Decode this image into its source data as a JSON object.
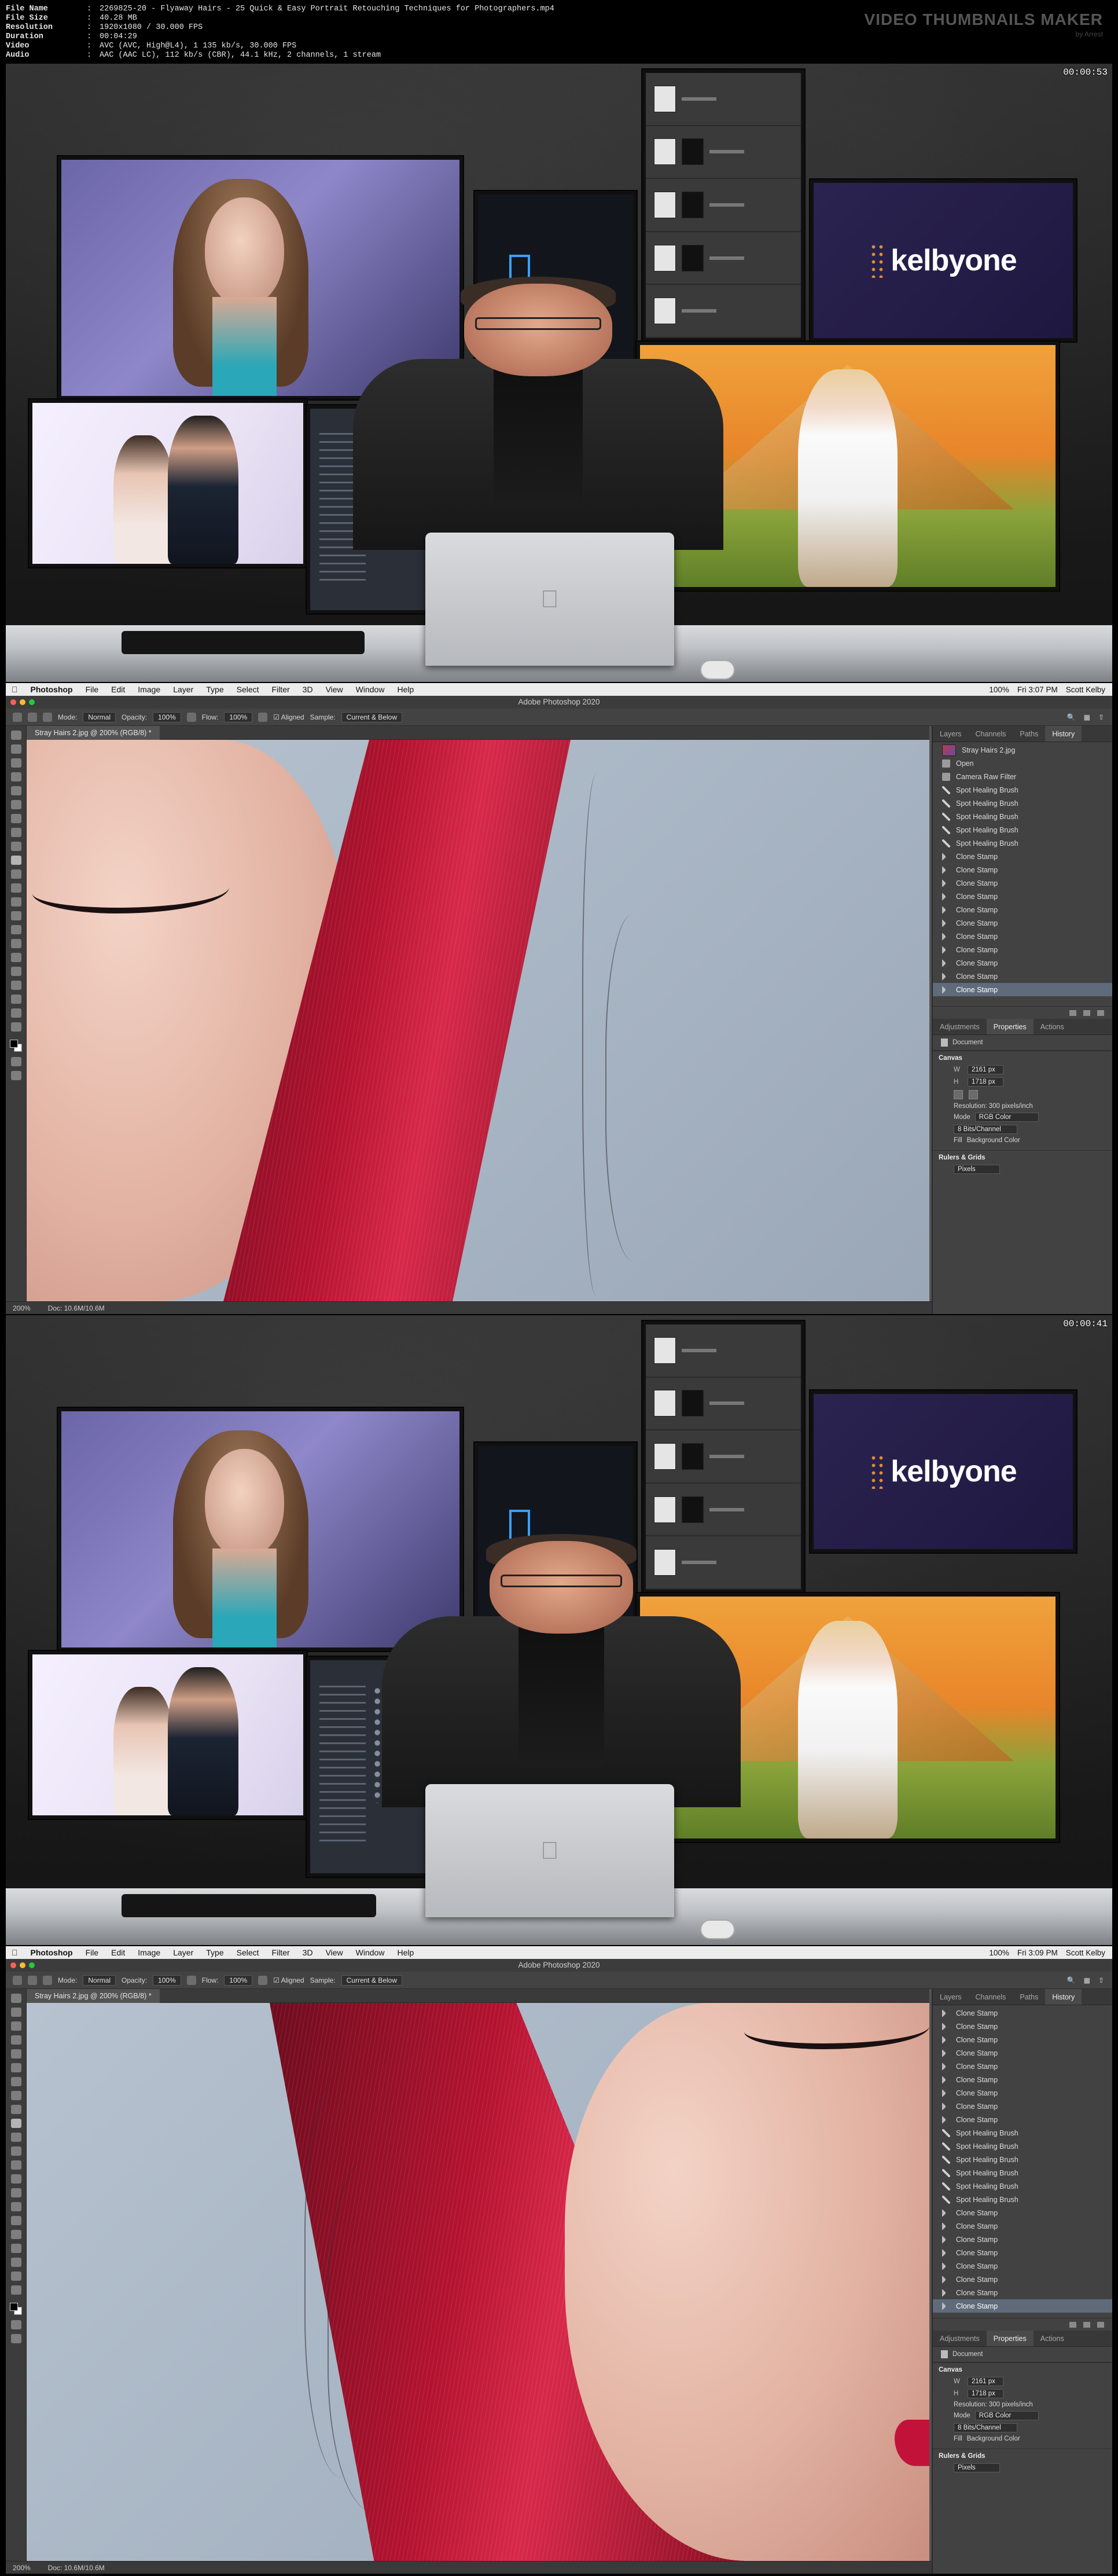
{
  "header": {
    "lines": [
      {
        "key": "File Name",
        "value": "2269825-20 - Flyaway Hairs - 25 Quick & Easy Portrait Retouching Techniques for Photographers.mp4"
      },
      {
        "key": "File Size",
        "value": "40.28 MB"
      },
      {
        "key": "Resolution",
        "value": "1920x1080 / 30.000 FPS"
      },
      {
        "key": "Duration",
        "value": "00:04:29"
      },
      {
        "key": "Video",
        "value": "AVC (AVC, High@L4), 1 135 kb/s, 30.000 FPS"
      },
      {
        "key": "Audio",
        "value": "AAC (AAC LC), 112 kb/s (CBR), 44.1 kHz, 2 channels, 1 stream"
      }
    ],
    "brand_title": "VIDEO THUMBNAILS MAKER",
    "brand_sub": "by Arrest"
  },
  "frames": [
    {
      "timestamp": "00:00:53",
      "kelby_logo": "kelbyone"
    },
    {
      "menubar": {
        "app": "Photoshop",
        "menus": [
          "File",
          "Edit",
          "Image",
          "Layer",
          "Type",
          "Select",
          "Filter",
          "3D",
          "View",
          "Window",
          "Help"
        ],
        "status": [
          "100%",
          "Fri 3:07 PM",
          "Scott Kelby"
        ]
      },
      "title": "Adobe Photoshop 2020",
      "options": {
        "mode_label": "Mode:",
        "mode": "Normal",
        "opacity_label": "Opacity:",
        "opacity": "100%",
        "flow_label": "Flow:",
        "flow": "100%",
        "aligned": "Aligned",
        "sample_label": "Sample:",
        "sample": "Current & Below"
      },
      "doc_tab": "Stray Hairs 2.jpg @ 200% (RGB/8) *",
      "panel_tabs": [
        "Layers",
        "Channels",
        "Paths",
        "History"
      ],
      "history": [
        "Stray Hairs 2.jpg",
        "Open",
        "Camera Raw Filter",
        "Spot Healing Brush",
        "Spot Healing Brush",
        "Spot Healing Brush",
        "Spot Healing Brush",
        "Spot Healing Brush",
        "Clone Stamp",
        "Clone Stamp",
        "Clone Stamp",
        "Clone Stamp",
        "Clone Stamp",
        "Clone Stamp",
        "Clone Stamp",
        "Clone Stamp",
        "Clone Stamp",
        "Clone Stamp",
        "Clone Stamp"
      ],
      "props_tabs": [
        "Adjustments",
        "Properties",
        "Actions"
      ],
      "props": {
        "document": "Document",
        "canvas": "Canvas",
        "w_label": "W",
        "w": "2161 px",
        "h_label": "H",
        "h": "1718 px",
        "resolution": "Resolution: 300 pixels/inch",
        "mode_label": "Mode",
        "mode": "RGB Color",
        "depth": "8 Bits/Channel",
        "fill_label": "Fill",
        "fill": "Background Color",
        "rulers": "Rulers & Grids",
        "units": "Pixels"
      },
      "status": {
        "zoom": "200%",
        "doc_size": "Doc: 10.6M/10.6M"
      }
    },
    {
      "timestamp": "00:00:41",
      "kelby_logo": "kelbyone"
    },
    {
      "menubar": {
        "app": "Photoshop",
        "menus": [
          "File",
          "Edit",
          "Image",
          "Layer",
          "Type",
          "Select",
          "Filter",
          "3D",
          "View",
          "Window",
          "Help"
        ],
        "status": [
          "100%",
          "Fri 3:09 PM",
          "Scott Kelby"
        ]
      },
      "title": "Adobe Photoshop 2020",
      "options": {
        "mode_label": "Mode:",
        "mode": "Normal",
        "opacity_label": "Opacity:",
        "opacity": "100%",
        "flow_label": "Flow:",
        "flow": "100%",
        "aligned": "Aligned",
        "sample_label": "Sample:",
        "sample": "Current & Below"
      },
      "doc_tab": "Stray Hairs 2.jpg @ 200% (RGB/8) *",
      "panel_tabs": [
        "Layers",
        "Channels",
        "Paths",
        "History"
      ],
      "history": [
        "Clone Stamp",
        "Clone Stamp",
        "Clone Stamp",
        "Clone Stamp",
        "Clone Stamp",
        "Clone Stamp",
        "Clone Stamp",
        "Clone Stamp",
        "Clone Stamp",
        "Spot Healing Brush",
        "Spot Healing Brush",
        "Spot Healing Brush",
        "Spot Healing Brush",
        "Spot Healing Brush",
        "Spot Healing Brush",
        "Clone Stamp",
        "Clone Stamp",
        "Clone Stamp",
        "Clone Stamp",
        "Clone Stamp",
        "Clone Stamp",
        "Clone Stamp",
        "Clone Stamp"
      ],
      "props_tabs": [
        "Adjustments",
        "Properties",
        "Actions"
      ],
      "props": {
        "document": "Document",
        "canvas": "Canvas",
        "w_label": "W",
        "w": "2161 px",
        "h_label": "H",
        "h": "1718 px",
        "resolution": "Resolution: 300 pixels/inch",
        "mode_label": "Mode",
        "mode": "RGB Color",
        "depth": "8 Bits/Channel",
        "fill_label": "Fill",
        "fill": "Background Color",
        "rulers": "Rulers & Grids",
        "units": "Pixels"
      },
      "status": {
        "zoom": "200%",
        "doc_size": "Doc: 10.6M/10.6M"
      }
    }
  ]
}
